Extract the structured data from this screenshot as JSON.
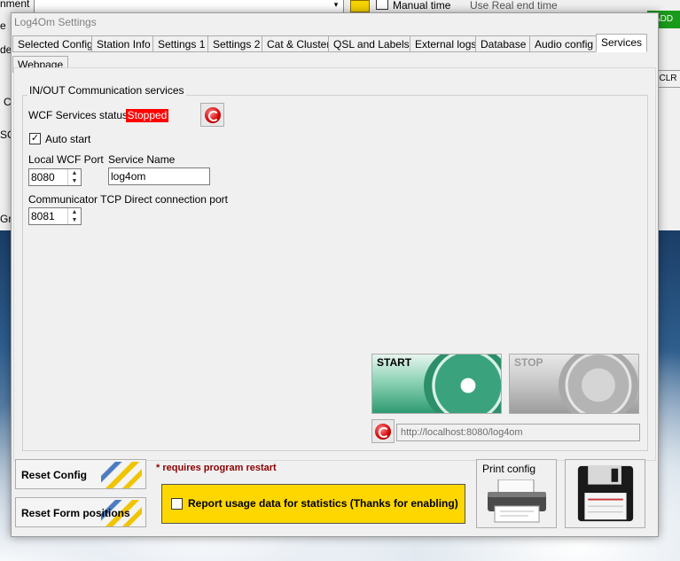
{
  "background": {
    "field_label_fragment": "nment",
    "manual_time_label": "Manual time",
    "real_end_label": "Use Real end time",
    "add_label": "ADD",
    "clr_label": "CLR",
    "left_fragments": [
      "e",
      "de",
      "Cl",
      "SO",
      "Gri"
    ]
  },
  "dialog": {
    "title": "Log4Om Settings",
    "tabs": [
      "Selected Config",
      "Station Info",
      "Settings 1",
      "Settings 2",
      "Cat & Cluster",
      "QSL and Labels",
      "External logs",
      "Database",
      "Audio config",
      "Services",
      "Webpage"
    ],
    "active_tab": "Services"
  },
  "services": {
    "group_title": "IN/OUT Communication services",
    "wcf_status_label": "WCF Services status",
    "wcf_status_value": "Stopped",
    "auto_start_label": "Auto start",
    "auto_start_checked": true,
    "local_port_label": "Local WCF Port",
    "local_port_value": "8080",
    "service_name_label": "Service Name",
    "service_name_value": "log4om",
    "tcp_port_label": "Communicator TCP Direct connection port",
    "tcp_port_value": "8081",
    "start_label": "START",
    "stop_label": "STOP",
    "url_value": "http://localhost:8080/log4om"
  },
  "footer": {
    "reset_config_label": "Reset Config",
    "reset_form_label": "Reset Form positions",
    "restart_note": "* requires program restart",
    "report_label": "Report usage data for statistics (Thanks for enabling)",
    "report_checked": false,
    "print_label": "Print config"
  },
  "colors": {
    "status_stopped": "#ff0000",
    "report_bg": "#ffd700",
    "restart_note": "#8b0000"
  }
}
